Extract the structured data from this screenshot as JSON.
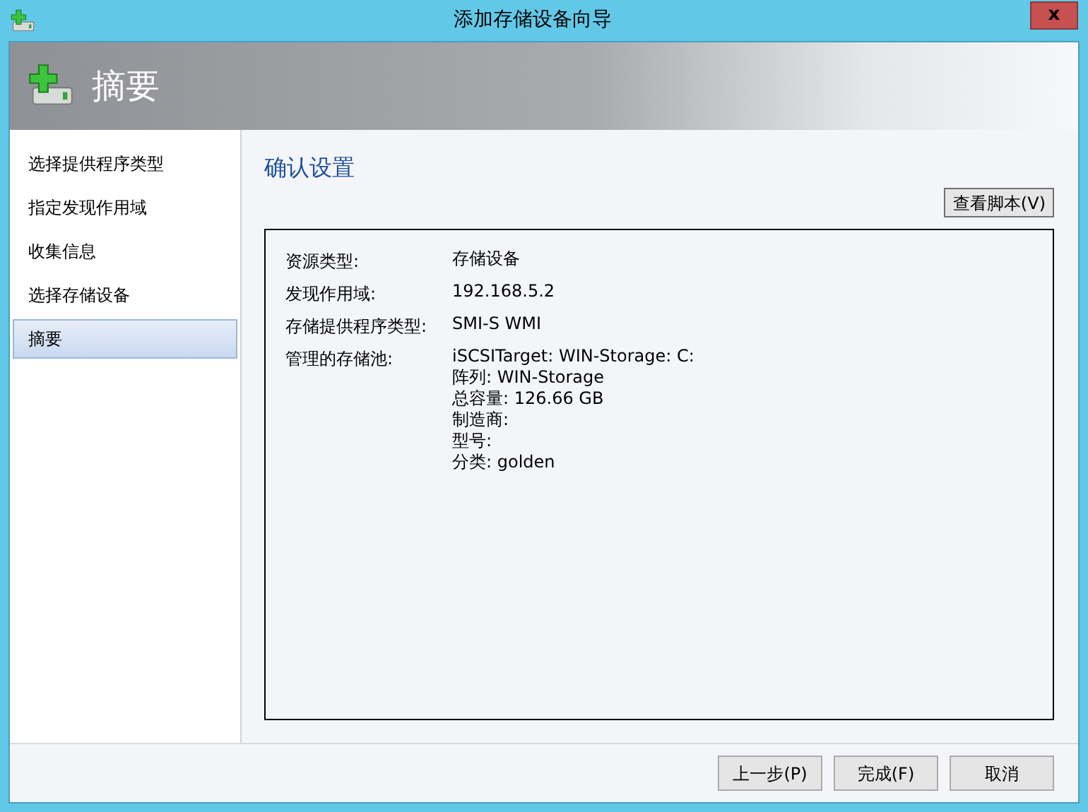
{
  "window": {
    "title": "添加存储设备向导",
    "close": "x"
  },
  "header": {
    "title": "摘要"
  },
  "sidebar": {
    "items": [
      {
        "label": "选择提供程序类型",
        "selected": false
      },
      {
        "label": "指定发现作用域",
        "selected": false
      },
      {
        "label": "收集信息",
        "selected": false
      },
      {
        "label": "选择存储设备",
        "selected": false
      },
      {
        "label": "摘要",
        "selected": true
      }
    ]
  },
  "content": {
    "title": "确认设置",
    "script_button": "查看脚本(V)",
    "details": [
      {
        "label": "资源类型:",
        "values": [
          "存储设备"
        ]
      },
      {
        "label": "发现作用域:",
        "values": [
          "192.168.5.2"
        ]
      },
      {
        "label": "存储提供程序类型:",
        "values": [
          "SMI-S WMI"
        ]
      },
      {
        "label": "管理的存储池:",
        "values": [
          "iSCSITarget: WIN-Storage: C:",
          "阵列: WIN-Storage",
          "总容量: 126.66 GB",
          "制造商:",
          "型号:",
          "分类: golden"
        ]
      }
    ]
  },
  "buttons": [
    "上一步(P)",
    "完成(F)",
    "取消"
  ]
}
